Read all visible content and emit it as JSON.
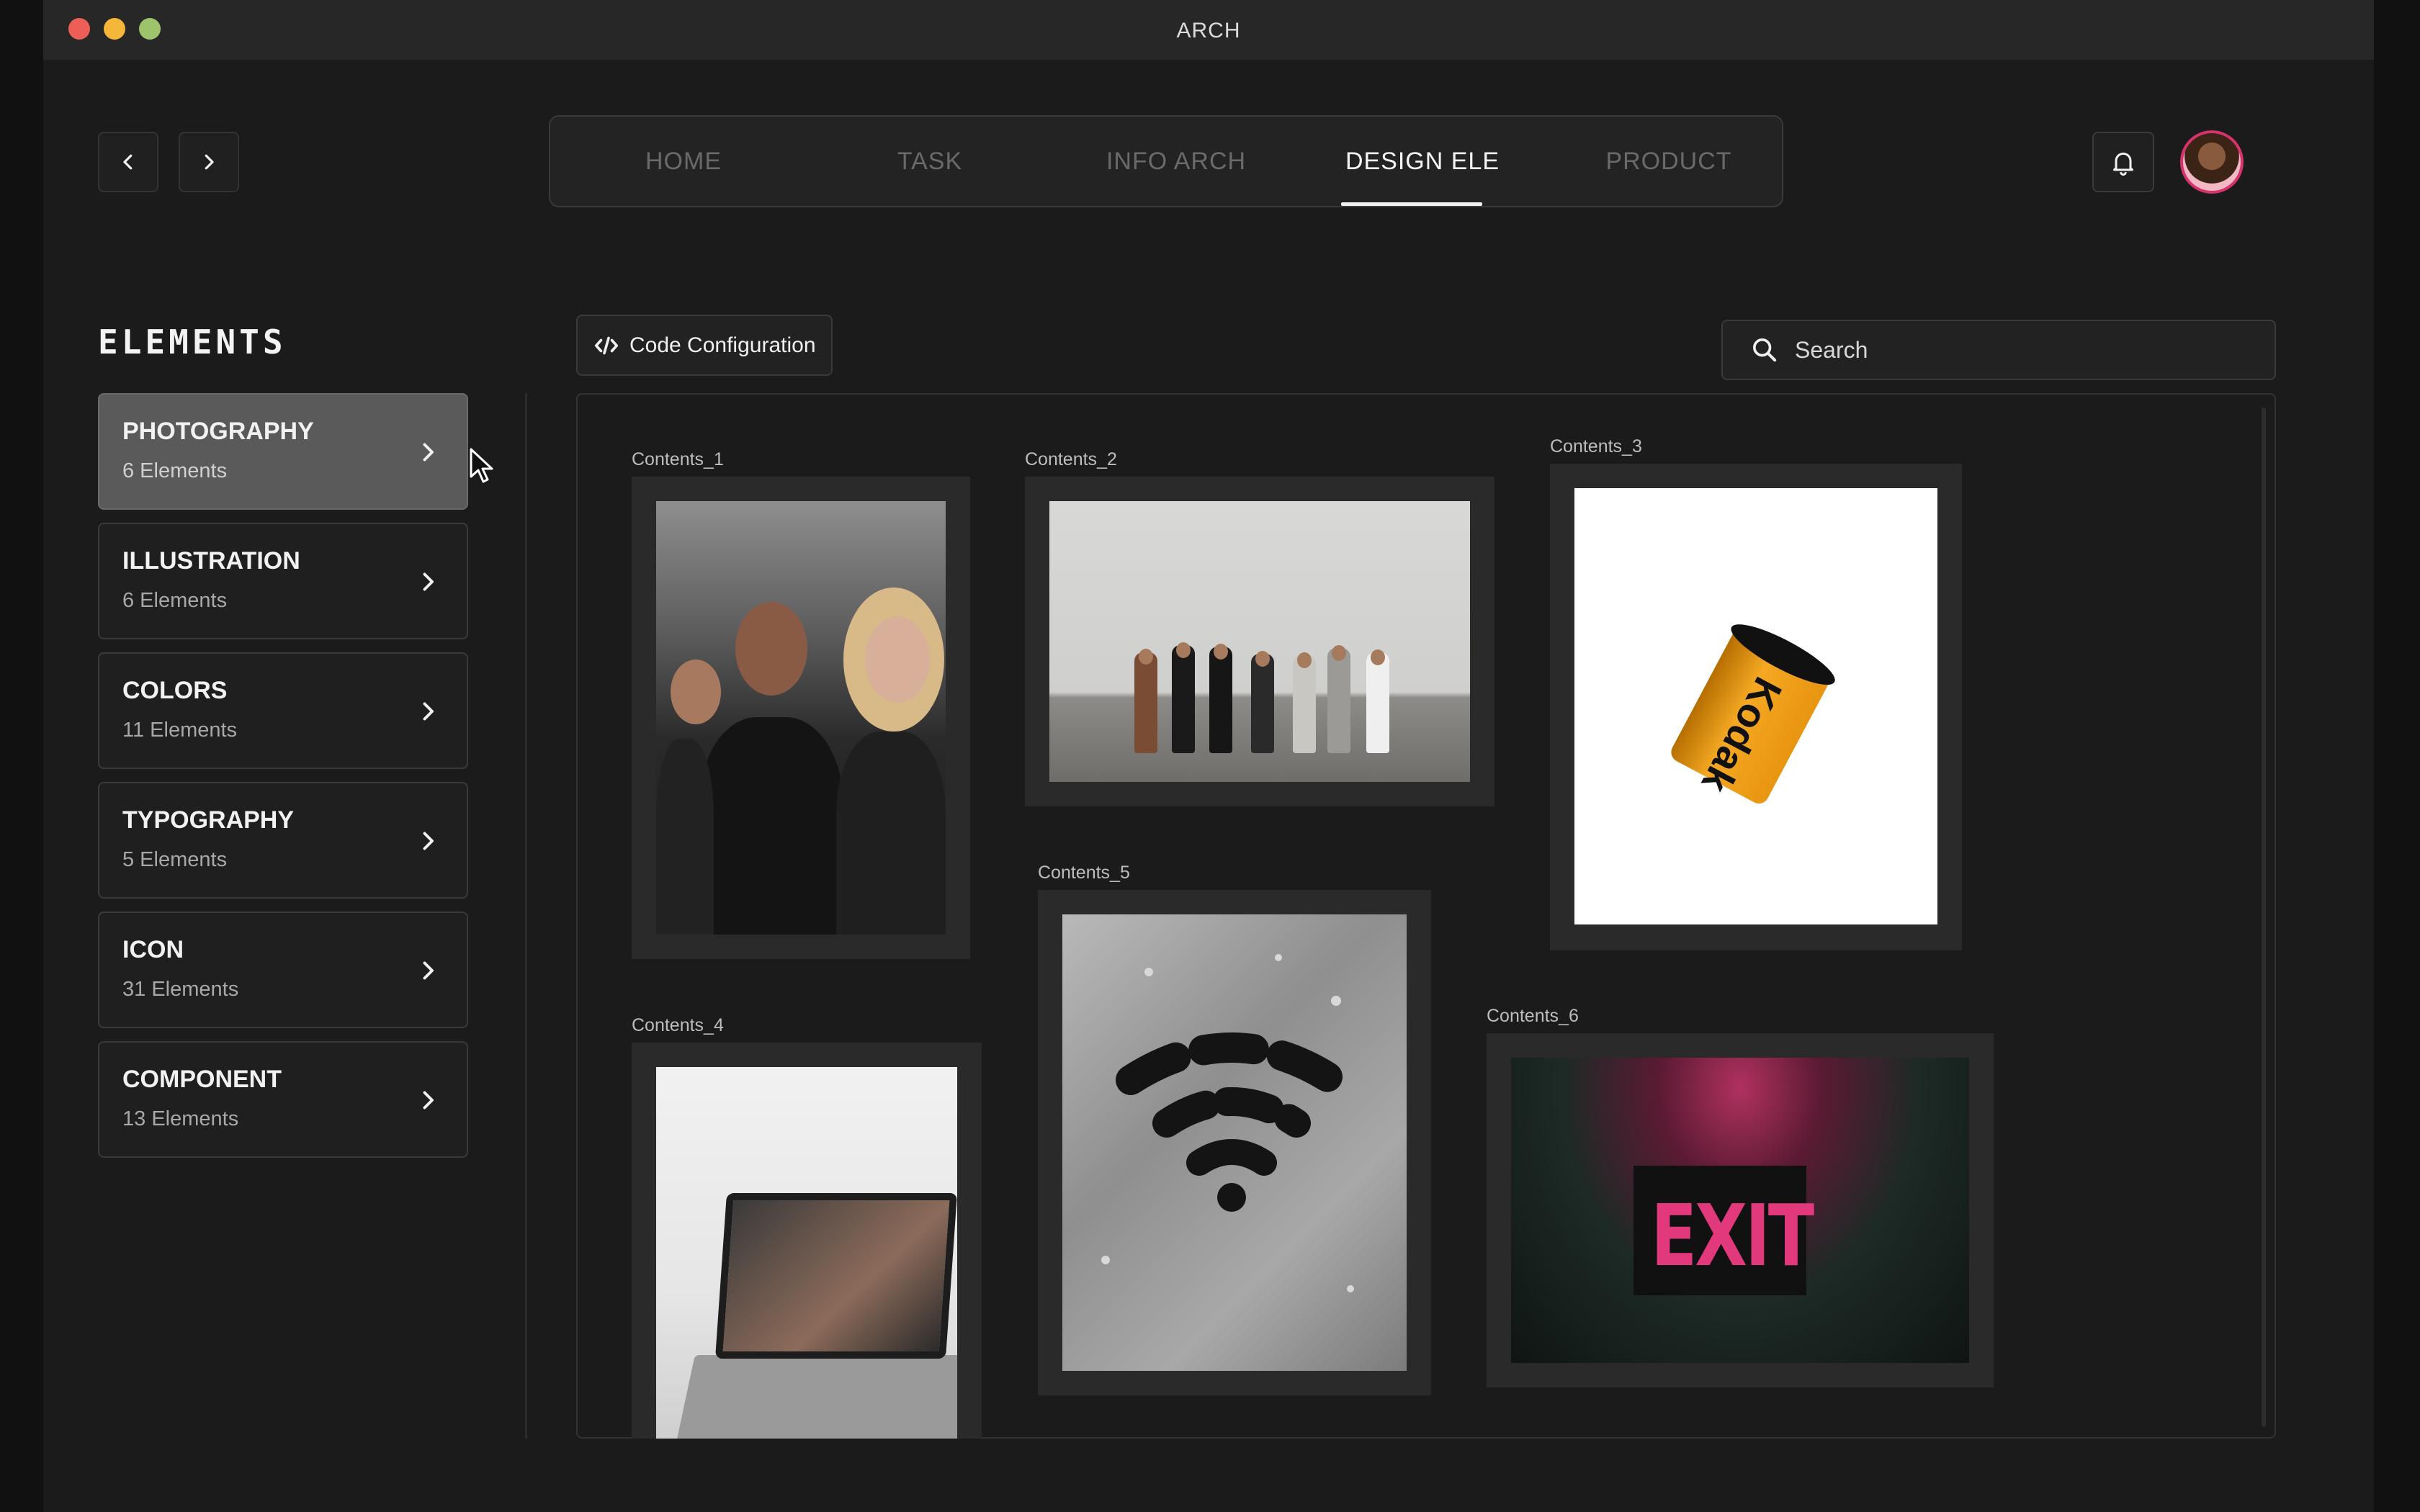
{
  "window": {
    "title": "ARCH"
  },
  "nav": {
    "tabs": [
      {
        "label": "HOME"
      },
      {
        "label": "TASK"
      },
      {
        "label": "INFO ARCH"
      },
      {
        "label": "DESIGN ELE"
      },
      {
        "label": "PRODUCT"
      }
    ],
    "active_tab": "DESIGN ELE"
  },
  "sidebar": {
    "title": "ELEMENTS",
    "active_category": "PHOTOGRAPHY",
    "categories": [
      {
        "name": "PHOTOGRAPHY",
        "count": "6 Elements"
      },
      {
        "name": "ILLUSTRATION",
        "count": "6 Elements"
      },
      {
        "name": "COLORS",
        "count": "11 Elements"
      },
      {
        "name": "TYPOGRAPHY",
        "count": "5 Elements"
      },
      {
        "name": "ICON",
        "count": "31 Elements"
      },
      {
        "name": "COMPONENT",
        "count": "13 Elements"
      }
    ]
  },
  "toolbar": {
    "code_config_label": "Code Configuration"
  },
  "search": {
    "placeholder": "Search"
  },
  "contents": [
    {
      "label": "Contents_1"
    },
    {
      "label": "Contents_2"
    },
    {
      "label": "Contents_3"
    },
    {
      "label": "Contents_4"
    },
    {
      "label": "Contents_5"
    },
    {
      "label": "Contents_6"
    }
  ],
  "photo_text": {
    "film_brand": "Kodak",
    "exit_sign": "EXIT"
  },
  "colors": {
    "background": "#1b1b1b",
    "titlebar": "#272727",
    "accent_avatar_ring": "#d6336c",
    "active_category": "#5a5a5a"
  },
  "icons": {
    "back": "chevron-left-icon",
    "forward": "chevron-right-icon",
    "notification": "bell-icon",
    "code": "code-icon",
    "search": "search-icon",
    "category_arrow": "chevron-right-icon"
  }
}
